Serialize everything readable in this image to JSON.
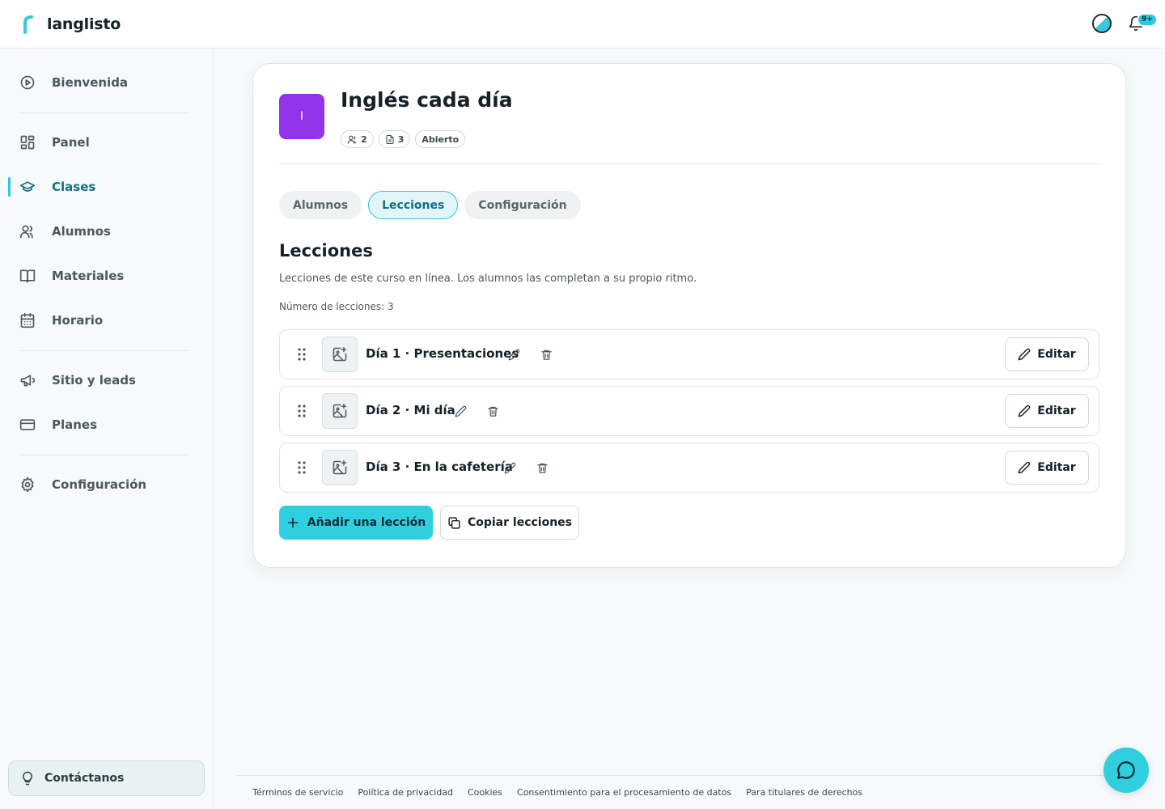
{
  "app": {
    "brand": "langlisto"
  },
  "header": {
    "notifications_badge": "9+"
  },
  "sidebar": {
    "items": [
      {
        "key": "bienvenida",
        "label": "Bienvenida",
        "icon": "play-circle-icon",
        "active": false
      },
      {
        "key": "panel",
        "label": "Panel",
        "icon": "dashboard-icon",
        "active": false
      },
      {
        "key": "clases",
        "label": "Clases",
        "icon": "graduation-cap-icon",
        "active": true
      },
      {
        "key": "alumnos",
        "label": "Alumnos",
        "icon": "users-icon",
        "active": false
      },
      {
        "key": "materiales",
        "label": "Materiales",
        "icon": "book-icon",
        "active": false
      },
      {
        "key": "horario",
        "label": "Horario",
        "icon": "calendar-icon",
        "active": false
      },
      {
        "key": "sitio",
        "label": "Sitio y leads",
        "icon": "megaphone-icon",
        "active": false
      },
      {
        "key": "planes",
        "label": "Planes",
        "icon": "credit-card-icon",
        "active": false
      },
      {
        "key": "configuracion",
        "label": "Configuración",
        "icon": "gear-icon",
        "active": false
      }
    ],
    "contact_label": "Contáctanos"
  },
  "class": {
    "avatar_letter": "I",
    "avatar_color": "#9333ea",
    "title": "Inglés cada día",
    "students_count": "2",
    "lessons_count": "3",
    "status": "Abierto"
  },
  "tabs": [
    {
      "label": "Alumnos",
      "active": false
    },
    {
      "label": "Lecciones",
      "active": true
    },
    {
      "label": "Configuración",
      "active": false
    }
  ],
  "lessons_section": {
    "title": "Lecciones",
    "description": "Lecciones de este curso en línea. Los alumnos las completan a su propio ritmo.",
    "count_text": "Número de lecciones: 3",
    "lessons": [
      {
        "name": "Día 1 · Presentaciones",
        "edit_label": "Editar"
      },
      {
        "name": "Día 2 · Mi día",
        "edit_label": "Editar"
      },
      {
        "name": "Día 3 · En la cafetería",
        "edit_label": "Editar"
      }
    ],
    "add_label": "Añadir una lección",
    "copy_label": "Copiar lecciones"
  },
  "footer": {
    "links": [
      "Términos de servicio",
      "Política de privacidad",
      "Cookies",
      "Consentimiento para el procesamiento de datos",
      "Para titulares de derechos"
    ]
  },
  "colors": {
    "accent": "#2fcfe0",
    "active_text": "#12717f"
  }
}
